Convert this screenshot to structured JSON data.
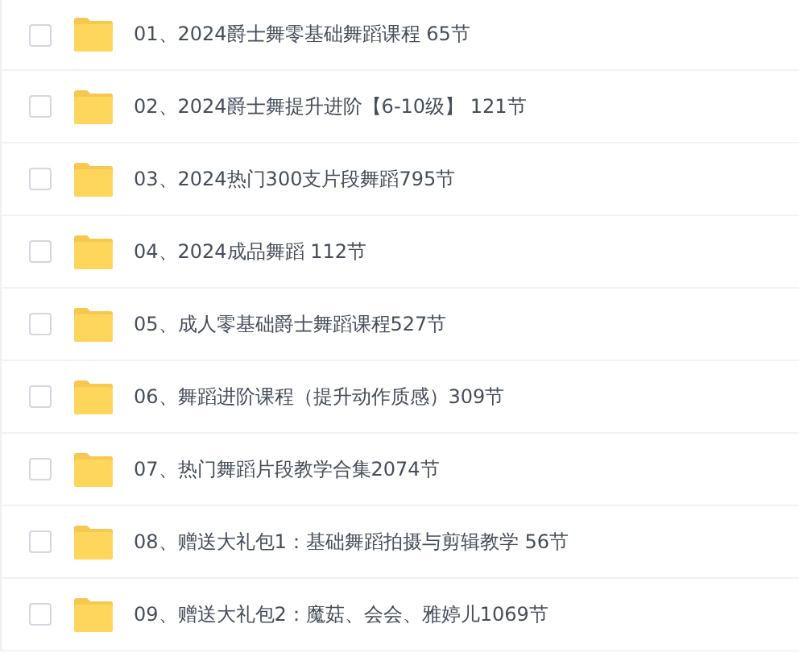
{
  "files": [
    {
      "name": "01、2024爵士舞零基础舞蹈课程 65节",
      "checked": false
    },
    {
      "name": "02、2024爵士舞提升进阶【6-10级】 121节",
      "checked": false
    },
    {
      "name": "03、2024热门300支片段舞蹈795节",
      "checked": false
    },
    {
      "name": "04、2024成品舞蹈 112节",
      "checked": false
    },
    {
      "name": "05、成人零基础爵士舞蹈课程527节",
      "checked": false
    },
    {
      "name": "06、舞蹈进阶课程（提升动作质感）309节",
      "checked": false
    },
    {
      "name": "07、热门舞蹈片段教学合集2074节",
      "checked": false
    },
    {
      "name": "08、赠送大礼包1：基础舞蹈拍摄与剪辑教学 56节",
      "checked": false
    },
    {
      "name": "09、赠送大礼包2：魔菇、会会、雅婷儿1069节",
      "checked": false
    }
  ]
}
